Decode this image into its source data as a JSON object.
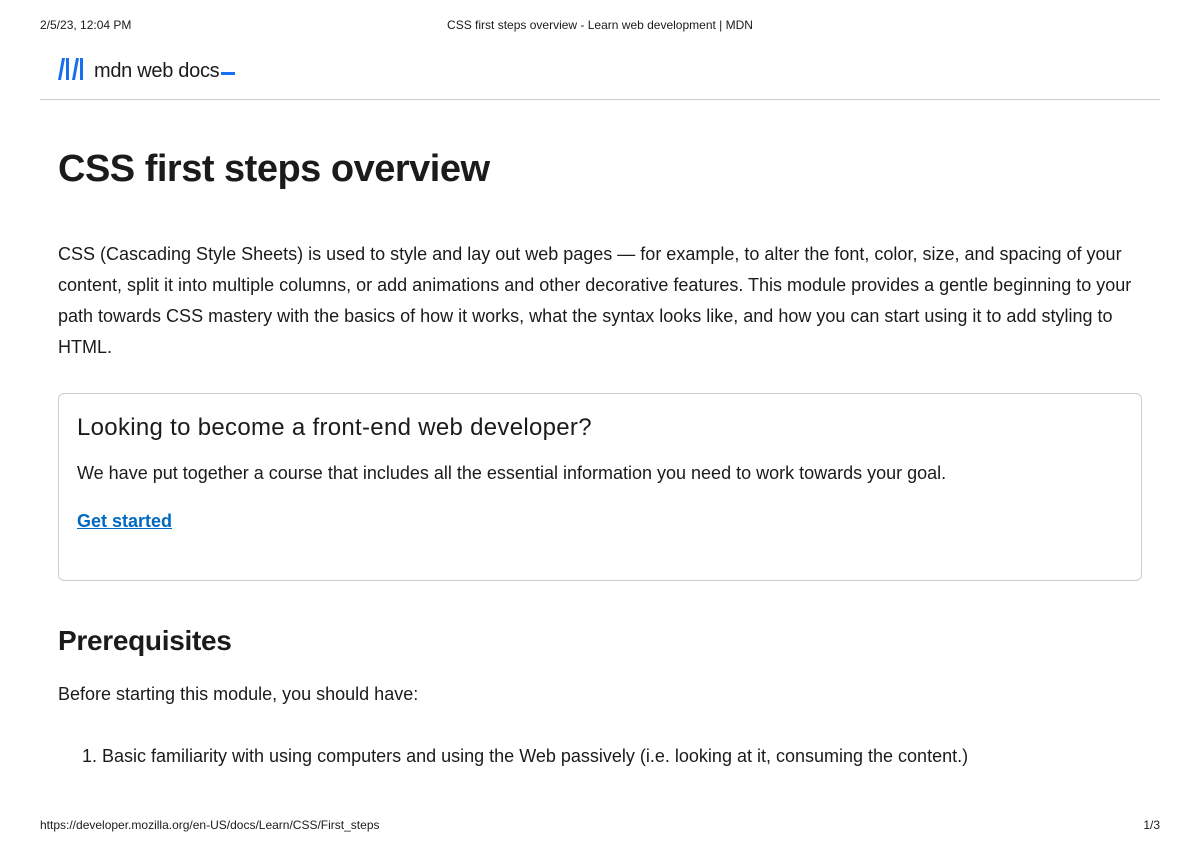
{
  "print_header": {
    "timestamp": "2/5/23, 12:04 PM",
    "doc_title": "CSS first steps overview - Learn web development | MDN"
  },
  "logo": {
    "text": "mdn web docs"
  },
  "page": {
    "title": "CSS first steps overview",
    "intro": "CSS (Cascading Style Sheets) is used to style and lay out web pages — for example, to alter the font, color, size, and spacing of your content, split it into multiple columns, or add animations and other decorative features. This module provides a gentle beginning to your path towards CSS mastery with the basics of how it works, what the syntax looks like, and how you can start using it to add styling to HTML."
  },
  "callout": {
    "title": "Looking to become a front-end web developer?",
    "text": "We have put together a course that includes all the essential information you need to work towards your goal.",
    "link_label": "Get started"
  },
  "prerequisites": {
    "heading": "Prerequisites",
    "intro": "Before starting this module, you should have:",
    "items": [
      "Basic familiarity with using computers and using the Web passively (i.e. looking at it, consuming the content.)"
    ]
  },
  "print_footer": {
    "url": "https://developer.mozilla.org/en-US/docs/Learn/CSS/First_steps",
    "page_number": "1/3"
  }
}
